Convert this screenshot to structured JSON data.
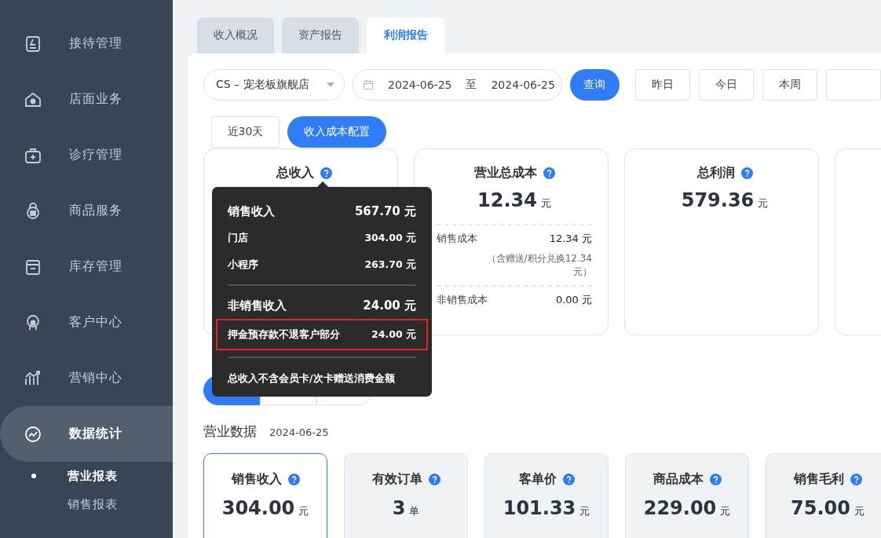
{
  "sidebar": {
    "items": [
      {
        "label": "接待管理",
        "selected": false
      },
      {
        "label": "店面业务",
        "selected": false
      },
      {
        "label": "诊疗管理",
        "selected": false
      },
      {
        "label": "商品服务",
        "selected": false
      },
      {
        "label": "库存管理",
        "selected": false
      },
      {
        "label": "客户中心",
        "selected": false
      },
      {
        "label": "营销中心",
        "selected": false
      },
      {
        "label": "数据统计",
        "selected": true,
        "children": [
          {
            "label": "营业报表",
            "selected": true
          },
          {
            "label": "销售报表",
            "selected": false
          }
        ]
      }
    ]
  },
  "tabs": [
    {
      "label": "收入概况",
      "selected": false
    },
    {
      "label": "资产报告",
      "selected": false
    },
    {
      "label": "利润报告",
      "selected": true
    }
  ],
  "filters": {
    "store": "CS – 宠老板旗舰店",
    "date_from": "2024-06-25",
    "date_sep": "至",
    "date_to": "2024-06-25",
    "query": "查询",
    "periods": [
      {
        "label": "昨日"
      },
      {
        "label": "今日"
      },
      {
        "label": "本周"
      }
    ],
    "recent": "近30天",
    "config": "收入成本配置"
  },
  "summary_cards": [
    {
      "title": "总收入"
    },
    {
      "title": "营业总成本",
      "value": "12.34",
      "unit": "元",
      "lines": [
        {
          "label": "销售成本",
          "value": "12.34 元",
          "note": "（含赠送/积分兑换12.34元）"
        },
        {
          "label": "非销售成本",
          "value": "0.00 元"
        }
      ]
    },
    {
      "title": "总利润",
      "value": "579.36",
      "unit": "元"
    }
  ],
  "tooltip": {
    "sections": [
      {
        "title": "销售收入",
        "value": "567.70 元",
        "highlighted": false,
        "items": [
          {
            "label": "门店",
            "value": "304.00 元"
          },
          {
            "label": "小程序",
            "value": "263.70 元"
          }
        ]
      },
      {
        "title": "非销售收入",
        "value": "24.00 元",
        "highlighted": true,
        "items": [
          {
            "label": "押金预存款不退客户部分",
            "value": "24.00 元"
          }
        ]
      }
    ],
    "note": "总收入不含会员卡/次卡赠送消费金额"
  },
  "channels": [
    {
      "selected": true
    },
    {
      "selected": false
    },
    {
      "selected": false
    }
  ],
  "business": {
    "title": "营业数据",
    "date": "2024-06-25",
    "metrics": [
      {
        "label": "销售收入",
        "value": "304.00",
        "unit": "元",
        "selected": true
      },
      {
        "label": "有效订单",
        "value": "3",
        "unit": "单",
        "selected": false
      },
      {
        "label": "客单价",
        "value": "101.33",
        "unit": "元",
        "selected": false
      },
      {
        "label": "商品成本",
        "value": "229.00",
        "unit": "元",
        "selected": false
      },
      {
        "label": "销售毛利",
        "value": "75.00",
        "unit": "元",
        "selected": false
      }
    ]
  }
}
